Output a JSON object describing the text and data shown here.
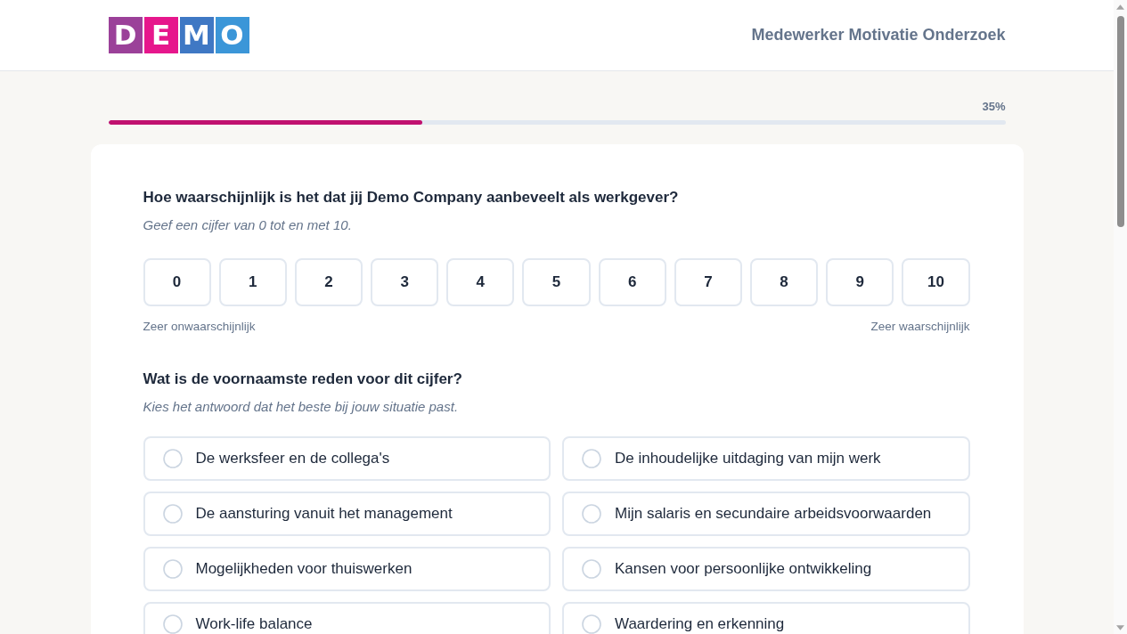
{
  "header": {
    "logo": [
      {
        "letter": "D",
        "color": "#9b4199"
      },
      {
        "letter": "E",
        "color": "#e6178c"
      },
      {
        "letter": "M",
        "color": "#3f78c4"
      },
      {
        "letter": "O",
        "color": "#3b96d8"
      }
    ],
    "title": "Medewerker Motivatie Onderzoek"
  },
  "progress": {
    "label": "35%",
    "level": 0.35
  },
  "questions": [
    {
      "kind": "scale",
      "title": "Hoe waarschijnlijk is het dat jij Demo Company aanbeveelt als werkgever?",
      "hint": "Geef een cijfer van 0 tot en met 10.",
      "options": [
        {
          "label": "0",
          "selected": false
        },
        {
          "label": "1",
          "selected": false
        },
        {
          "label": "2",
          "selected": false
        },
        {
          "label": "3",
          "selected": false
        },
        {
          "label": "4",
          "selected": false
        },
        {
          "label": "5",
          "selected": false
        },
        {
          "label": "6",
          "selected": false
        },
        {
          "label": "7",
          "selected": false
        },
        {
          "label": "8",
          "selected": false
        },
        {
          "label": "9",
          "selected": false
        },
        {
          "label": "10",
          "selected": false
        }
      ],
      "low_label": "Zeer onwaarschijnlijk",
      "high_label": "Zeer waarschijnlijk"
    },
    {
      "kind": "choice",
      "title": "Wat is de voornaamste reden voor dit cijfer?",
      "hint": "Kies het antwoord dat het beste bij jouw situatie past.",
      "options": [
        {
          "label": "De werksfeer en de collega's",
          "selected": false
        },
        {
          "label": "De inhoudelijke uitdaging van mijn werk",
          "selected": false
        },
        {
          "label": "De aansturing vanuit het management",
          "selected": false
        },
        {
          "label": "Mijn salaris en secundaire arbeidsvoorwaarden",
          "selected": false
        },
        {
          "label": "Mogelijkheden voor thuiswerken",
          "selected": false
        },
        {
          "label": "Kansen voor persoonlijke ontwikkeling",
          "selected": false
        },
        {
          "label": "Work-life balance",
          "selected": false
        },
        {
          "label": "Waardering en erkenning",
          "selected": false
        }
      ]
    }
  ]
}
